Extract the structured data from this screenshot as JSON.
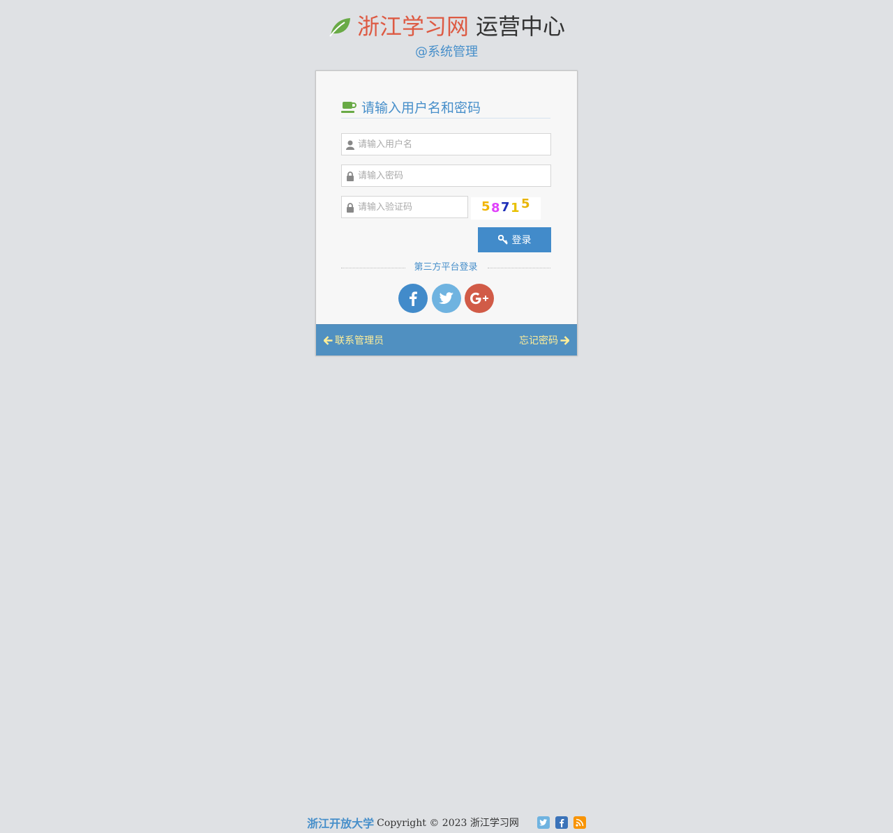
{
  "header": {
    "brand_red": "浙江学习网",
    "brand_dark": "运营中心",
    "subtitle": "@系统管理"
  },
  "login": {
    "title": "请输入用户名和密码",
    "username": {
      "value": "",
      "placeholder": "请输入用户名"
    },
    "password": {
      "value": "",
      "placeholder": "请输入密码"
    },
    "captcha_input": {
      "value": "",
      "placeholder": "请输入验证码"
    },
    "captcha_image": {
      "digits": [
        "5",
        "8",
        "7",
        "1",
        "5"
      ],
      "colors": [
        "#f0b400",
        "#e040fb",
        "#1e2fb8",
        "#e8c000",
        "#e8b400"
      ]
    },
    "submit_label": "登录",
    "third_party_label": "第三方平台登录",
    "social": [
      {
        "name": "facebook-icon",
        "color": "#428bca"
      },
      {
        "name": "twitter-icon",
        "color": "#6fb3e0"
      },
      {
        "name": "google-plus-icon",
        "color": "#d15b47"
      }
    ]
  },
  "toolbar": {
    "contact_admin": "联系管理员",
    "forgot_password": "忘记密码"
  },
  "footer": {
    "university": "浙江开放大学",
    "copyright": "Copyright © 2023 浙江学习网",
    "icons": [
      {
        "name": "twitter-square-icon",
        "color": "#6fb3e0"
      },
      {
        "name": "facebook-square-icon",
        "color": "#3b73b9"
      },
      {
        "name": "rss-square-icon",
        "color": "#f89406"
      }
    ]
  },
  "colors": {
    "background": "#dfe1e4",
    "accent_blue": "#478fca",
    "brand_red": "#dd5a43",
    "leaf_green": "#69aa46",
    "button_blue": "#428bca",
    "footer_link_yellow": "#ffee99"
  }
}
